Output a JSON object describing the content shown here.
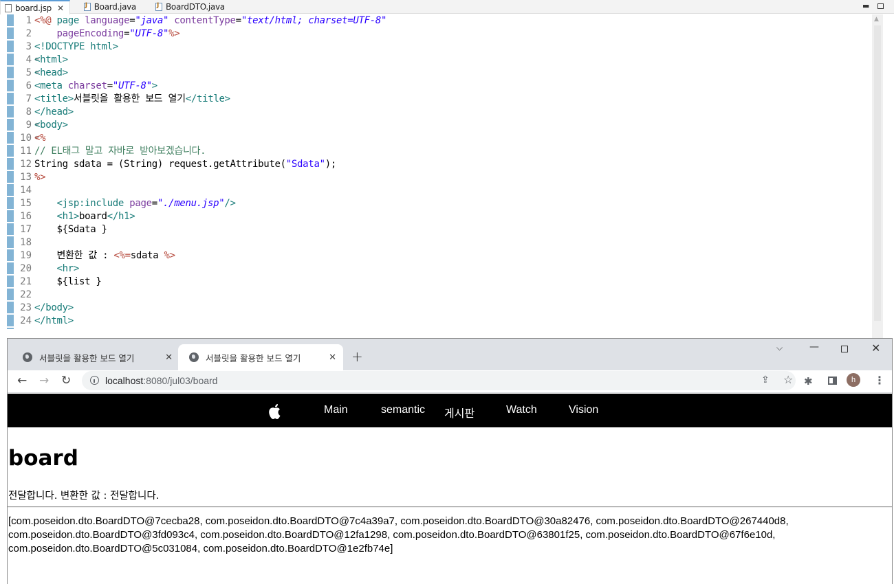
{
  "ide": {
    "tabs": [
      {
        "label": "board.jsp",
        "close": "✕"
      },
      {
        "label": "Board.java"
      },
      {
        "label": "BoardDTO.java"
      }
    ],
    "line_numbers": [
      "1",
      "2",
      "3",
      "4",
      "5",
      "6",
      "7",
      "8",
      "9",
      "10",
      "11",
      "12",
      "13",
      "14",
      "15",
      "16",
      "17",
      "18",
      "19",
      "20",
      "21",
      "22",
      "23",
      "24"
    ],
    "code": {
      "l1": {
        "a": "<%@ ",
        "b": "page ",
        "c": "language",
        "d": "=",
        "e": "\"java\"",
        "f": " contentType",
        "g": "=",
        "h": "\"text/html; charset=UTF-8\""
      },
      "l2": {
        "a": "    pageEncoding",
        "b": "=",
        "c": "\"UTF-8\"",
        "d": "%>"
      },
      "l3": "<!DOCTYPE html>",
      "l4": "<html>",
      "l5": "<head>",
      "l6": {
        "a": "<meta ",
        "b": "charset",
        "c": "=",
        "d": "\"UTF-8\"",
        "e": ">"
      },
      "l7": {
        "a": "<title>",
        "b": "서블릿을 활용한 보드 열기",
        "c": "</title>"
      },
      "l8": "</head>",
      "l9": "<body>",
      "l10": "<%",
      "l11": "// EL태그 말고 자바로 받아보겠습니다.",
      "l12": {
        "a": "String sdata = (String) request.getAttribute(",
        "b": "\"Sdata\"",
        "c": ");"
      },
      "l13": "%>",
      "l15": {
        "a": "    <jsp:include ",
        "b": "page",
        "c": "=",
        "d": "\"./menu.jsp\"",
        "e": "/>"
      },
      "l16": {
        "a": "    <h1>",
        "b": "board",
        "c": "</h1>"
      },
      "l17": "    ${Sdata }",
      "l19": {
        "a": "    변환한 값 : ",
        "b": "<%=",
        "c": "sdata ",
        "d": "%>"
      },
      "l20": "    <hr>",
      "l21": "    ${list }",
      "l23": "</body>",
      "l24": "</html>"
    }
  },
  "browser": {
    "tabs": [
      {
        "title": "서블릿을 활용한 보드 열기",
        "close": "✕"
      },
      {
        "title": "서블릿을 활용한 보드 열기",
        "close": "✕"
      }
    ],
    "new_tab": "+",
    "url_host": "localhost",
    "url_path": ":8080/jul03/board",
    "avatar_letter": "h",
    "menu": [
      "Main",
      "semantic",
      "게시판",
      "Watch",
      "Vision"
    ],
    "page": {
      "heading": "board",
      "line1": "전달합니다. 변환한 값 : 전달합니다.",
      "list": "[com.poseidon.dto.BoardDTO@7cecba28, com.poseidon.dto.BoardDTO@7c4a39a7, com.poseidon.dto.BoardDTO@30a82476, com.poseidon.dto.BoardDTO@267440d8, com.poseidon.dto.BoardDTO@3fd093c4, com.poseidon.dto.BoardDTO@12fa1298, com.poseidon.dto.BoardDTO@63801f25, com.poseidon.dto.BoardDTO@67f6e10d, com.poseidon.dto.BoardDTO@5c031084, com.poseidon.dto.BoardDTO@1e2fb74e]"
    }
  }
}
